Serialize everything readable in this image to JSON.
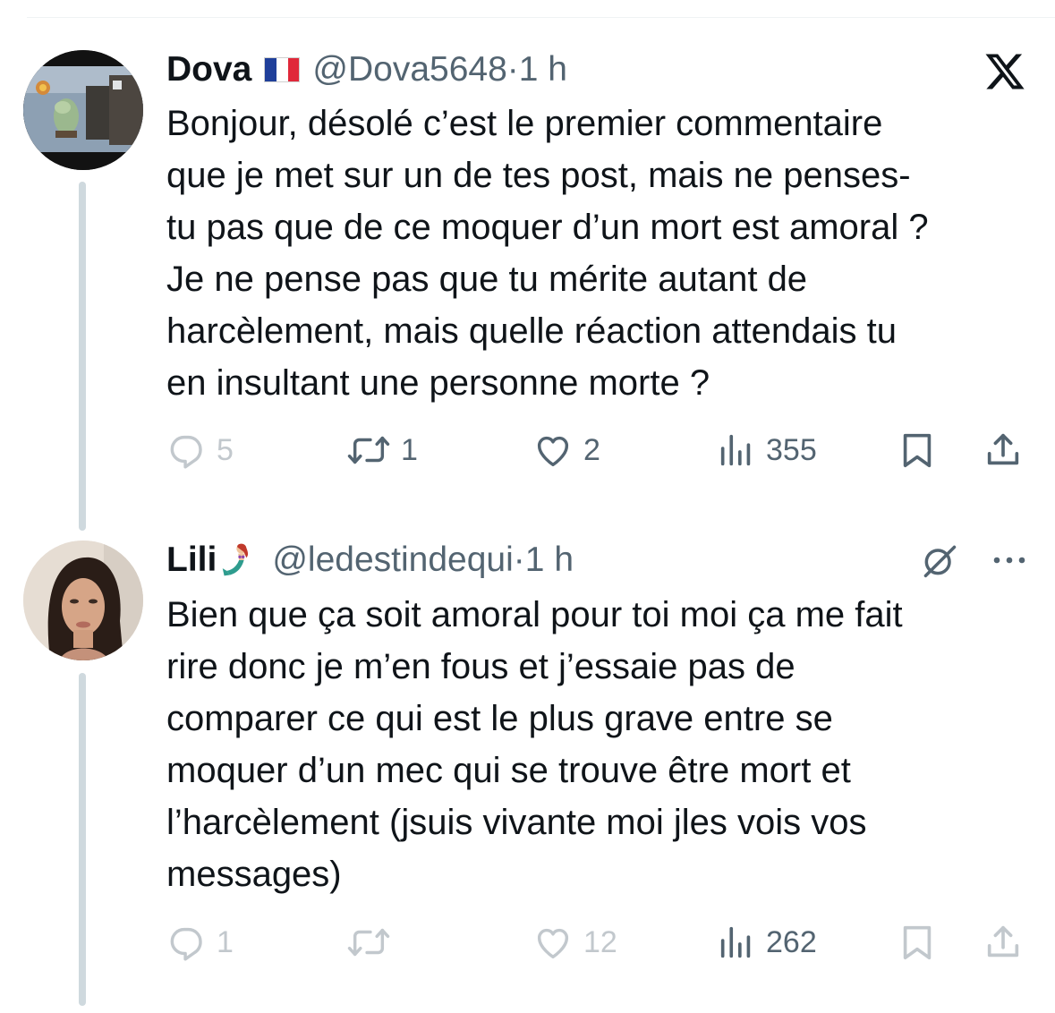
{
  "tweets": [
    {
      "name": "Dova",
      "handle": "@Dova5648",
      "time": "1 h",
      "text": "Bonjour, désolé c’est le premier commentaire\nque je met sur un de tes post, mais ne penses-\ntu pas que de ce moquer d’un mort est amoral ?\nJe ne pense pas que tu mérite autant de\nharcèlement, mais quelle réaction attendais tu\nen insultant une personne morte ?",
      "replies": "5",
      "retweets": "1",
      "likes": "2",
      "views": "355"
    },
    {
      "name": "Lili",
      "handle": "@ledestindequi",
      "time": "1 h",
      "text": "Bien que ça soit amoral pour toi moi ça me fait\nrire donc je m’en fous et j’essaie pas de\ncomparer ce qui est le plus grave entre se\nmoquer d’un mec qui se trouve être mort et\nl’harcèlement (jsuis vivante moi jles vois vos\nmessages)",
      "replies": "1",
      "retweets": "",
      "likes": "12",
      "views": "262"
    }
  ],
  "icons": {
    "app_logo": "x-logo-icon",
    "flag": "france-flag-icon",
    "emoji": "mermaid-emoji-icon",
    "reply": "reply-icon",
    "retweet": "retweet-icon",
    "like": "like-icon",
    "views": "views-icon",
    "bookmark": "bookmark-icon",
    "share": "share-icon",
    "grok": "grok-icon",
    "more": "more-icon"
  },
  "colors": {
    "text": "#0f1419",
    "secondary": "#536471",
    "thread_line": "#cfd9de"
  }
}
